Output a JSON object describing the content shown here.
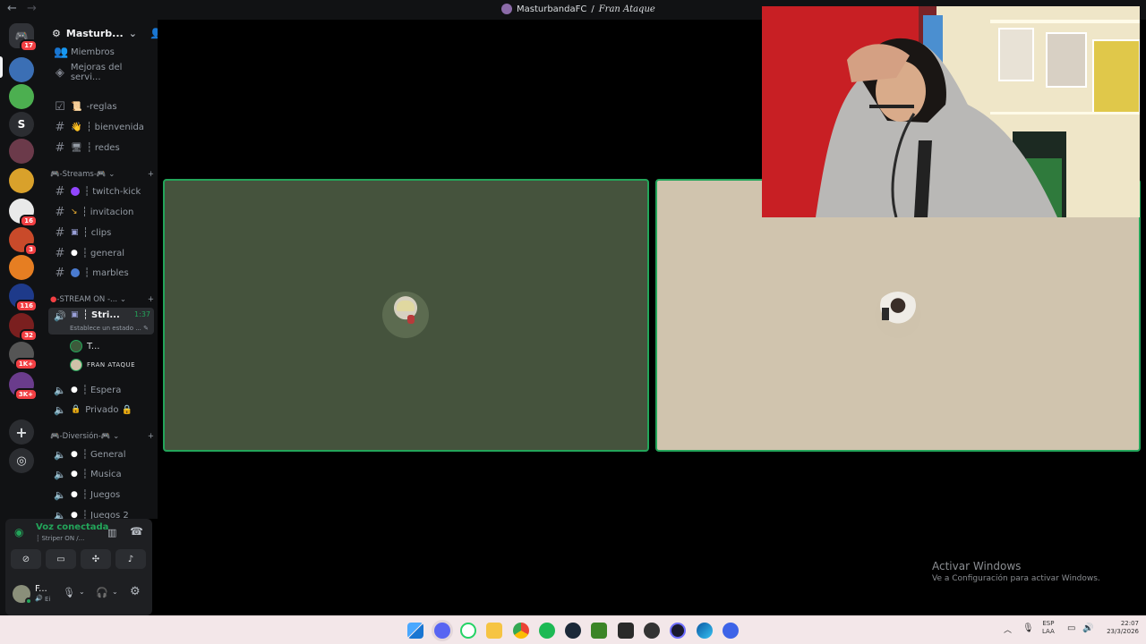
{
  "window": {
    "title_server": "MasturbandaFC",
    "title_sep": " / ",
    "title_channel": "Fran Ataque",
    "back_icon": "arrow-left-icon",
    "forward_icon": "arrow-right-icon"
  },
  "rail": {
    "servers": [
      {
        "name": "discord-home",
        "badge": "17",
        "color": "#5865f2",
        "letter": ""
      },
      {
        "name": "server-1",
        "badge": "",
        "color": "#3b6fb5",
        "letter": ""
      },
      {
        "name": "server-2",
        "badge": "",
        "color": "#4caf50",
        "letter": ""
      },
      {
        "name": "server-3",
        "badge": "",
        "color": "#2b2d31",
        "letter": "S"
      },
      {
        "name": "server-4",
        "badge": "",
        "color": "#6b3a4a",
        "letter": ""
      },
      {
        "name": "server-5",
        "badge": "",
        "color": "#d9a12b",
        "letter": ""
      },
      {
        "name": "server-6",
        "badge": "16",
        "color": "#e9e9e9",
        "letter": ""
      },
      {
        "name": "server-7",
        "badge": "3",
        "color": "#c94a2a",
        "letter": ""
      },
      {
        "name": "server-8",
        "badge": "",
        "color": "#e67e22",
        "letter": ""
      },
      {
        "name": "server-9",
        "badge": "116",
        "color": "#1e3a8a",
        "letter": ""
      },
      {
        "name": "server-10",
        "badge": "32",
        "color": "#7a1f1f",
        "letter": ""
      },
      {
        "name": "server-11",
        "badge": "1K+",
        "color": "#555",
        "letter": ""
      },
      {
        "name": "server-12",
        "badge": "3K+",
        "color": "#6a3c8c",
        "letter": ""
      }
    ],
    "add_icon": "plus-icon",
    "discover_icon": "compass-icon"
  },
  "sidebar": {
    "server_name": "Masturb...",
    "items_top": [
      {
        "label": "Miembros",
        "icon": "members-icon"
      },
      {
        "label": "Mejoras del servi...",
        "icon": "boost-icon"
      }
    ],
    "channels_1": [
      {
        "label": "-reglas",
        "prefix": "📜"
      },
      {
        "label": "┆ bienvenida",
        "prefix": "👋"
      },
      {
        "label": "┆ redes",
        "prefix": "🖥"
      }
    ],
    "category_streams": "-Streams-",
    "channels_2": [
      {
        "label": "┆ twitch-kick"
      },
      {
        "label": "┆ invitacion"
      },
      {
        "label": "┆ clips"
      },
      {
        "label": "┆ general"
      },
      {
        "label": "┆ marbles"
      }
    ],
    "category_stream_on": "-STREAM ON -...",
    "voice_active": {
      "label": "┆ Stri...",
      "time": "1:37",
      "status": "Establece un estado ..."
    },
    "voice_users": [
      {
        "name": "T..."
      },
      {
        "name": "FRAN ATAQUE"
      }
    ],
    "voice_channels_1": [
      {
        "label": "┆ Espera"
      },
      {
        "label": "Privado 🔒"
      }
    ],
    "category_diversion": "-Diversión-",
    "voice_channels_2": [
      {
        "label": "┆ General"
      },
      {
        "label": "┆ Musica"
      },
      {
        "label": "┆ Juegos"
      },
      {
        "label": "┆ Juegos 2"
      }
    ]
  },
  "voice_panel": {
    "title": "Voz conectada",
    "subtitle": "┆ Striper ON /...",
    "user_short": "F...",
    "user_sub": "Ei",
    "buttons": [
      "camera-off-icon",
      "screen-share-icon",
      "activities-icon",
      "soundboard-icon"
    ]
  },
  "watermark": {
    "line1": "Activar Windows",
    "line2": "Ve a Configuración para activar Windows."
  },
  "tray": {
    "lang1": "ESP",
    "lang2": "LAA",
    "time": "22:07",
    "date": "23/3/2026"
  },
  "colors": {
    "tile_left": "#45533d",
    "tile_right": "#d0c4ae",
    "speaking_border": "#23a55a",
    "taskbar": "#f3e7e9"
  }
}
